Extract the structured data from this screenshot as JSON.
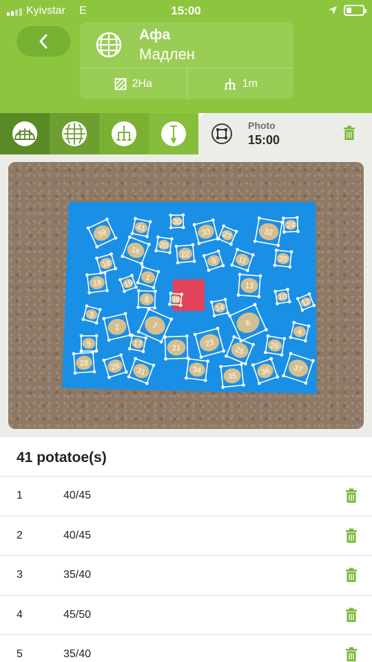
{
  "status_bar": {
    "carrier": "Kyivstar",
    "network": "E",
    "time": "15:00"
  },
  "header": {
    "back_icon": "chevron-left-icon",
    "crop": "Афа",
    "variety": "Мадлен",
    "area": "2Ha",
    "spacing": "1m",
    "field_icon": "globe-grid-icon",
    "area_icon": "hatched-square-icon",
    "spacing_icon": "planting-rake-icon"
  },
  "tabs": [
    {
      "icon": "dome-grid-icon"
    },
    {
      "icon": "globe-grid-icon"
    },
    {
      "icon": "planting-rake-icon"
    },
    {
      "icon": "soil-probe-icon"
    }
  ],
  "photo_tab": {
    "label": "Photo",
    "time": "15:00",
    "icon": "crop-frame-icon",
    "delete_icon": "trash-icon"
  },
  "photo": {
    "description": "Potatoes on blue board with red reference square, each potato outlined and numbered",
    "labels": [
      "39",
      "41",
      "30",
      "33",
      "27",
      "32",
      "24",
      "18",
      "16",
      "20",
      "22",
      "9",
      "11",
      "20",
      "19",
      "15",
      "1",
      "13",
      "10",
      "12",
      "3",
      "8",
      "14",
      "6",
      "4",
      "5",
      "2",
      "7",
      "17",
      "21",
      "23",
      "25",
      "26",
      "28",
      "29",
      "31",
      "34",
      "35",
      "36",
      "37",
      "38"
    ]
  },
  "list": {
    "heading": "41 potatoe(s)",
    "items": [
      {
        "index": "1",
        "size": "40/45"
      },
      {
        "index": "2",
        "size": "40/45"
      },
      {
        "index": "3",
        "size": "35/40"
      },
      {
        "index": "4",
        "size": "45/50"
      },
      {
        "index": "5",
        "size": "35/40"
      }
    ]
  },
  "colors": {
    "header_green": "#8dc53f",
    "accent_green": "#7ab532",
    "board_blue": "#1a8fe6",
    "reference_red": "#e0435a"
  }
}
